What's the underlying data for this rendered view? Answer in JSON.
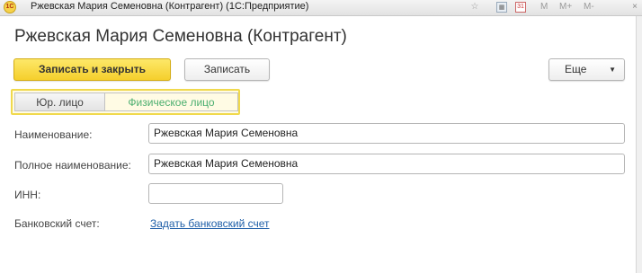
{
  "window": {
    "title": "Ржевская Мария Семеновна (Контрагент)  (1С:Предприятие)",
    "app_logo": "1С",
    "toolbar_items": [
      "М",
      "М+",
      "М-"
    ],
    "calendar_day": "31",
    "close_glyph": "×",
    "icons": [
      "app-logo-icon",
      "star-icon",
      "calculator-icon",
      "calendar-icon",
      "close-icon"
    ]
  },
  "page": {
    "title": "Ржевская Мария Семеновна (Контрагент)"
  },
  "toolbar": {
    "save_close_label": "Записать и закрыть",
    "save_label": "Записать",
    "more_label": "Еще",
    "more_caret": "▼"
  },
  "kind_switch": {
    "options": [
      "Юр. лицо",
      "Физическое лицо"
    ],
    "selected": "Физическое лицо"
  },
  "form": {
    "name_label": "Наименование:",
    "name_value": "Ржевская Мария Семеновна",
    "full_name_label": "Полное наименование:",
    "full_name_value": "Ржевская Мария Семеновна",
    "inn_label": "ИНН:",
    "inn_value": "",
    "bank_label": "Банковский счет:",
    "bank_link": "Задать банковский счет"
  },
  "colors": {
    "primary_button": "#f5cf2c",
    "selected_option_text": "#4caf70",
    "switch_border": "#f0d94d",
    "link": "#1f5fa8"
  }
}
